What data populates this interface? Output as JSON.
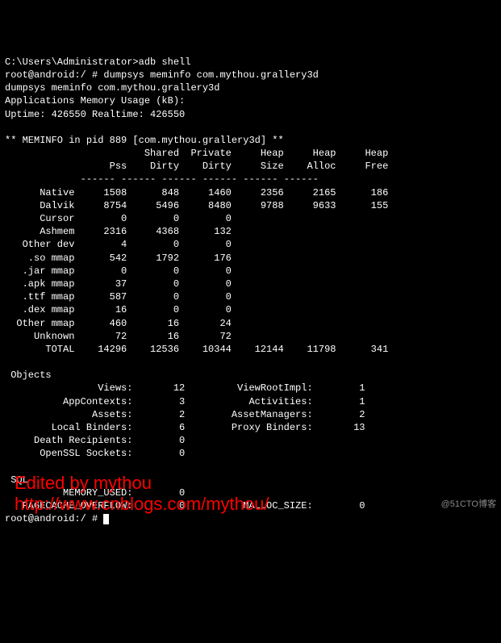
{
  "header": {
    "prompt1": "C:\\Users\\Administrator>adb shell",
    "prompt2": "root@android:/ # dumpsys meminfo com.mythou.grallery3d",
    "echo": "dumpsys meminfo com.mythou.grallery3d",
    "appline": "Applications Memory Usage (kB):",
    "uptime": "Uptime: 426550 Realtime: 426550"
  },
  "meminfo_title": "** MEMINFO in pid 889 [com.mythou.grallery3d] **",
  "columns": {
    "h1": {
      "c2": "Shared",
      "c3": "Private",
      "c4": "Heap",
      "c5": "Heap",
      "c6": "Heap"
    },
    "h2": {
      "c1": "Pss",
      "c2": "Dirty",
      "c3": "Dirty",
      "c4": "Size",
      "c5": "Alloc",
      "c6": "Free"
    }
  },
  "rows": [
    {
      "label": "Native",
      "pss": "1508",
      "sd": "848",
      "pd": "1460",
      "hs": "2356",
      "ha": "2165",
      "hf": "186"
    },
    {
      "label": "Dalvik",
      "pss": "8754",
      "sd": "5496",
      "pd": "8480",
      "hs": "9788",
      "ha": "9633",
      "hf": "155"
    },
    {
      "label": "Cursor",
      "pss": "0",
      "sd": "0",
      "pd": "0",
      "hs": "",
      "ha": "",
      "hf": ""
    },
    {
      "label": "Ashmem",
      "pss": "2316",
      "sd": "4368",
      "pd": "132",
      "hs": "",
      "ha": "",
      "hf": ""
    },
    {
      "label": "Other dev",
      "pss": "4",
      "sd": "0",
      "pd": "0",
      "hs": "",
      "ha": "",
      "hf": ""
    },
    {
      "label": ".so mmap",
      "pss": "542",
      "sd": "1792",
      "pd": "176",
      "hs": "",
      "ha": "",
      "hf": ""
    },
    {
      "label": ".jar mmap",
      "pss": "0",
      "sd": "0",
      "pd": "0",
      "hs": "",
      "ha": "",
      "hf": ""
    },
    {
      "label": ".apk mmap",
      "pss": "37",
      "sd": "0",
      "pd": "0",
      "hs": "",
      "ha": "",
      "hf": ""
    },
    {
      "label": ".ttf mmap",
      "pss": "587",
      "sd": "0",
      "pd": "0",
      "hs": "",
      "ha": "",
      "hf": ""
    },
    {
      "label": ".dex mmap",
      "pss": "16",
      "sd": "0",
      "pd": "0",
      "hs": "",
      "ha": "",
      "hf": ""
    },
    {
      "label": "Other mmap",
      "pss": "460",
      "sd": "16",
      "pd": "24",
      "hs": "",
      "ha": "",
      "hf": ""
    },
    {
      "label": "Unknown",
      "pss": "72",
      "sd": "16",
      "pd": "72",
      "hs": "",
      "ha": "",
      "hf": ""
    },
    {
      "label": "TOTAL",
      "pss": "14296",
      "sd": "12536",
      "pd": "10344",
      "hs": "12144",
      "ha": "11798",
      "hf": "341"
    }
  ],
  "objects_title": " Objects",
  "objects": [
    {
      "l1": "Views:",
      "v1": "12",
      "l2": "ViewRootImpl:",
      "v2": "1"
    },
    {
      "l1": "AppContexts:",
      "v1": "3",
      "l2": "Activities:",
      "v2": "1"
    },
    {
      "l1": "Assets:",
      "v1": "2",
      "l2": "AssetManagers:",
      "v2": "2"
    },
    {
      "l1": "Local Binders:",
      "v1": "6",
      "l2": "Proxy Binders:",
      "v2": "13"
    },
    {
      "l1": "Death Recipients:",
      "v1": "0",
      "l2": "",
      "v2": ""
    },
    {
      "l1": "OpenSSL Sockets:",
      "v1": "0",
      "l2": "",
      "v2": ""
    }
  ],
  "sql_title": " SQL",
  "sql": [
    {
      "l1": "MEMORY_USED:",
      "v1": "0",
      "l2": "",
      "v2": ""
    },
    {
      "l1": "PAGECACHE_OVERFLOW:",
      "v1": "0",
      "l2": "MALLOC_SIZE:",
      "v2": "0"
    }
  ],
  "final_prompt": "root@android:/ # ",
  "overlay": {
    "edited": "Edited by mythou",
    "url": "http://www.cnblogs.com/mythou/"
  },
  "watermark": "@51CTO博客"
}
